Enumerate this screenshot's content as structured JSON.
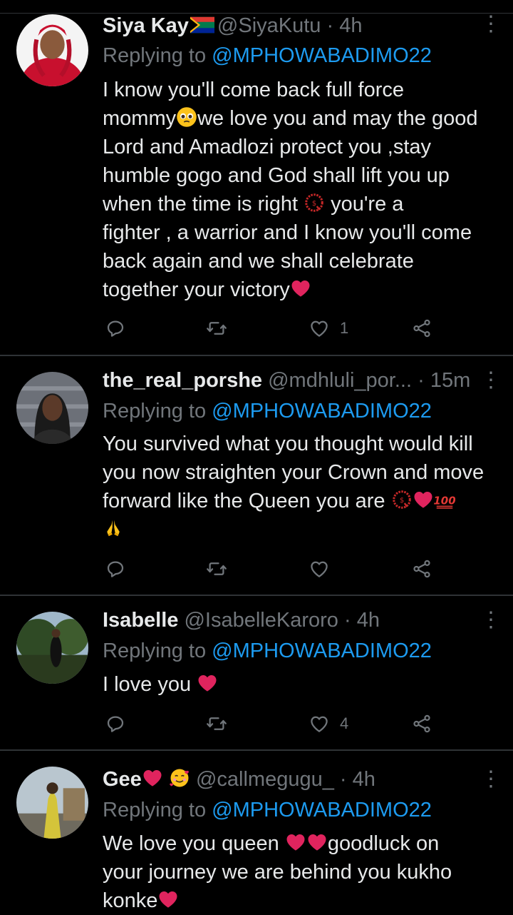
{
  "tweets": [
    {
      "name": "Siya Kay",
      "handle": "@SiyaKutu",
      "dot": "·",
      "time": "4h",
      "replying_label": "Replying to",
      "mention": "@MPHOWABADIMO22",
      "lines": [
        "I know you'll come back full force",
        "mommy",
        "we love you and may the good",
        "Lord and Amadlozi protect you ,stay",
        "humble gogo and God shall lift you up",
        "when the time is right",
        "you're a",
        "fighter , a warrior and I know you'll come",
        "back again and we shall celebrate",
        "together your victory"
      ],
      "likes": "1",
      "avatar_color": "#c8102e"
    },
    {
      "name": "the_real_porshe",
      "handle": "@mdhluli_por...",
      "dot": "·",
      "time": "15m",
      "replying_label": "Replying to",
      "mention": "@MPHOWABADIMO22",
      "lines": [
        "You survived what you thought would kill",
        "you now straighten your Crown and move",
        "forward like the Queen you are"
      ],
      "likes": "",
      "avatar_color": "#5a5e66"
    },
    {
      "name": "Isabelle",
      "handle": "@IsabelleKaroro",
      "dot": "·",
      "time": "4h",
      "replying_label": "Replying to",
      "mention": "@MPHOWABADIMO22",
      "lines": [
        "I love you"
      ],
      "likes": "4",
      "avatar_color": "#4f6b3a"
    },
    {
      "name": "Gee",
      "handle": "@callmegugu_",
      "dot": "·",
      "time": "4h",
      "replying_label": "Replying to",
      "mention": "@MPHOWABADIMO22",
      "lines": [
        "We love you queen",
        "goodluck on",
        "your journey we are behind you kukho",
        "konke"
      ],
      "likes": "",
      "avatar_color": "#d4c43a"
    }
  ],
  "icons": {
    "reply": "reply-icon",
    "retweet": "retweet-icon",
    "like": "heart-icon",
    "share": "share-icon",
    "menu": "more-icon"
  },
  "colors": {
    "background": "#000000",
    "text": "#e7e9ea",
    "muted": "#71767b",
    "link": "#1d9bf0",
    "heart": "#e0245e",
    "divider": "#2f3336"
  }
}
